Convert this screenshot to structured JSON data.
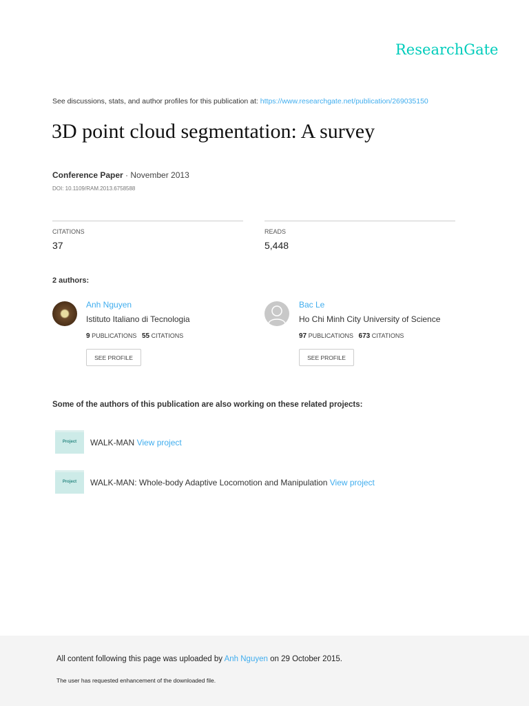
{
  "brand": "ResearchGate",
  "header": {
    "see_text": "See discussions, stats, and author profiles for this publication at:",
    "url": "https://www.researchgate.net/publication/269035150"
  },
  "publication": {
    "title": "3D point cloud segmentation: A survey",
    "type": "Conference Paper",
    "date_sep": " · November 2013",
    "doi": "DOI: 10.1109/RAM.2013.6758588"
  },
  "stats": {
    "citations_label": "CITATIONS",
    "citations": "37",
    "reads_label": "READS",
    "reads": "5,448"
  },
  "authors_heading": "2 authors:",
  "authors": [
    {
      "name": "Anh Nguyen",
      "institution": "Istituto Italiano di Tecnologia",
      "publications": "9",
      "publications_label": "PUBLICATIONS",
      "citations": "55",
      "citations_label": "CITATIONS",
      "button": "SEE PROFILE"
    },
    {
      "name": "Bac Le",
      "institution": "Ho Chi Minh City University of Science",
      "publications": "97",
      "publications_label": "PUBLICATIONS",
      "citations": "673",
      "citations_label": "CITATIONS",
      "button": "SEE PROFILE"
    }
  ],
  "projects_heading": "Some of the authors of this publication are also working on these related projects:",
  "projects": [
    {
      "badge": "Project",
      "name": "WALK-MAN",
      "link": "View project"
    },
    {
      "badge": "Project",
      "name": "WALK-MAN: Whole-body Adaptive Locomotion and Manipulation",
      "link": "View project"
    }
  ],
  "footer": {
    "uploaded_prefix": "All content following this page was uploaded by",
    "uploader": "Anh Nguyen",
    "uploaded_suffix": "on 29 October 2015.",
    "request_text": "The user has requested enhancement of the downloaded file."
  }
}
